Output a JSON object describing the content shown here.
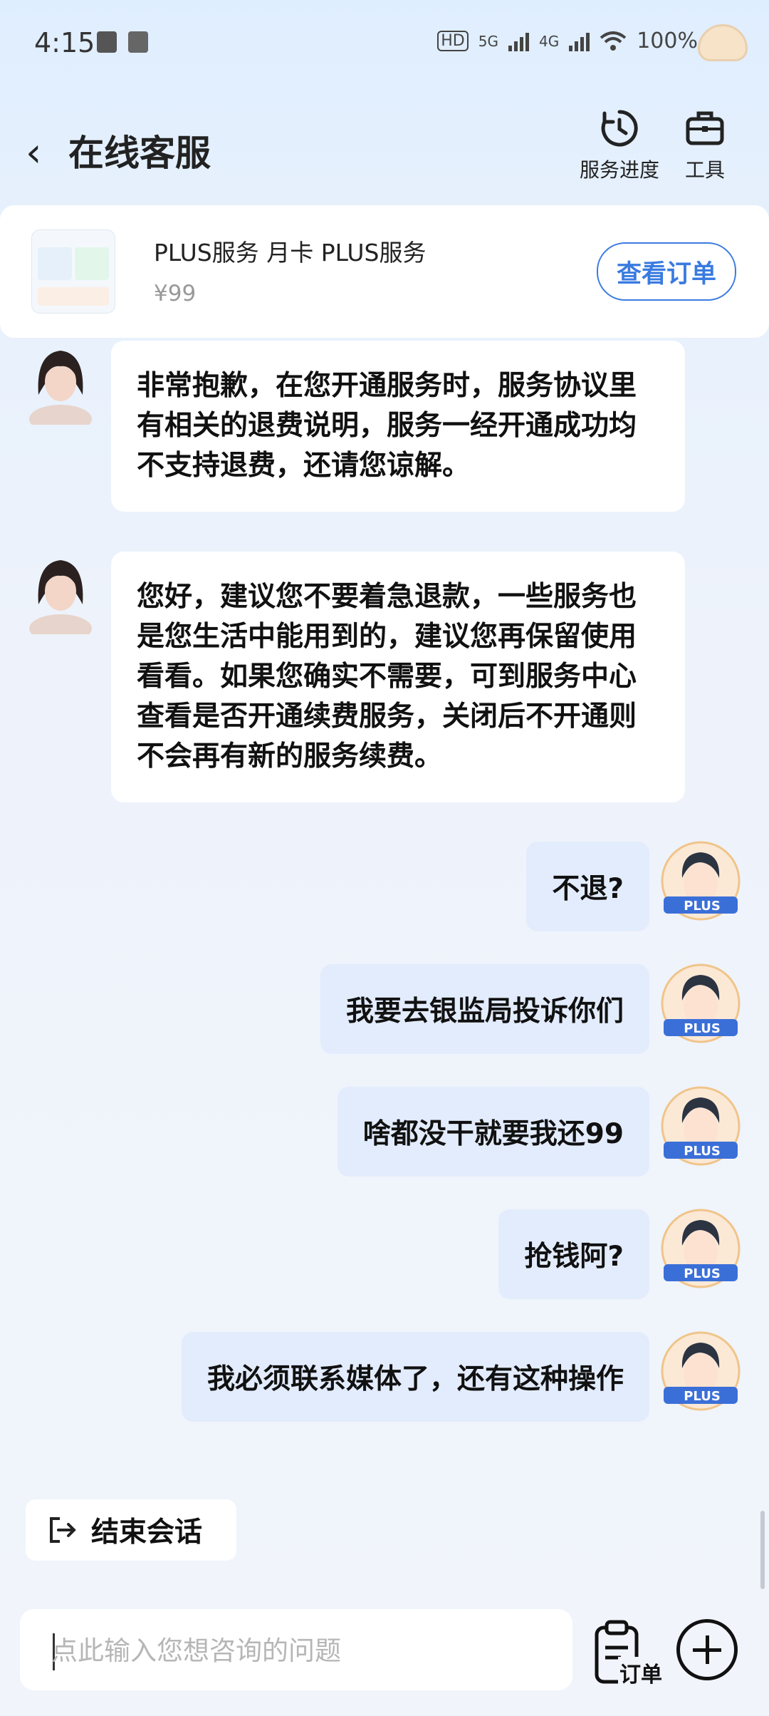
{
  "status_bar": {
    "time": "4:15",
    "battery": "100%",
    "network_1": "5G",
    "network_2": "4G",
    "hd_badge": "HD"
  },
  "header": {
    "title": "在线客服",
    "service_progress_label": "服务进度",
    "tools_label": "工具"
  },
  "order_card": {
    "title": "PLUS服务 月卡 PLUS服务",
    "price": "¥99",
    "view_order_label": "查看订单"
  },
  "messages": [
    {
      "from": "agent",
      "text": "非常抱歉，在您开通服务时，服务协议里有相关的退费说明，服务一经开通成功均不支持退费，还请您谅解。"
    },
    {
      "from": "agent",
      "text": "您好，建议您不要着急退款，一些服务也是您生活中能用到的，建议您再保留使用看看。如果您确实不需要，可到服务中心查看是否开通续费服务，关闭后不开通则不会再有新的服务续费。"
    },
    {
      "from": "user",
      "text": "不退?"
    },
    {
      "from": "user",
      "text": "我要去银监局投诉你们"
    },
    {
      "from": "user",
      "text": "啥都没干就要我还99"
    },
    {
      "from": "user",
      "text": "抢钱阿?"
    },
    {
      "from": "user",
      "text": "我必须联系媒体了，还有这种操作"
    }
  ],
  "user_avatar_badge": "PLUS",
  "end_chat_label": "结束会话",
  "input": {
    "placeholder": "点此输入您想咨询的问题",
    "value": ""
  },
  "order_button_label": "订单",
  "colors": {
    "accent": "#3a7be0",
    "user_bubble": "#e3ecfd",
    "agent_bubble": "#ffffff"
  }
}
